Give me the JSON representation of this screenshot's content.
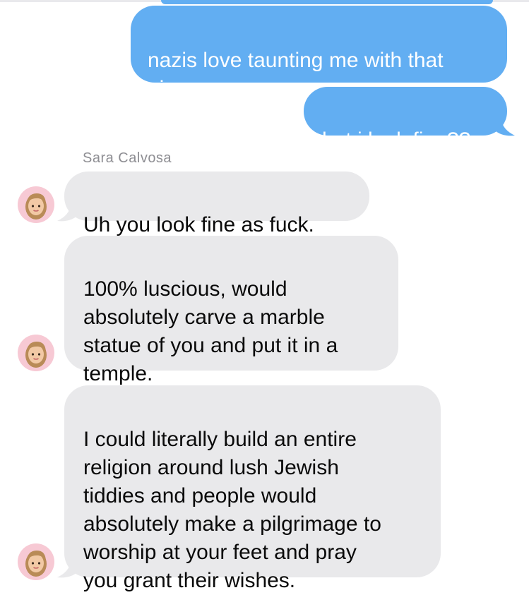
{
  "conversation": {
    "sender_name": "Sara Calvosa",
    "colors": {
      "outgoing_bubble": "#62aef2",
      "incoming_bubble": "#e9e9eb",
      "sender_label": "#8e8e93",
      "avatar_background": "#f7c9d4"
    },
    "avatar_icon": "memoji-avatar-icon",
    "messages": [
      {
        "direction": "outgoing",
        "text": "nazis love taunting me with that\npic"
      },
      {
        "direction": "outgoing",
        "text": "but i look fine??"
      },
      {
        "direction": "incoming",
        "text": "Uh you look fine as fuck."
      },
      {
        "direction": "incoming",
        "text": "100% luscious, would\nabsolutely carve a marble\nstatue of you and put it in a\ntemple."
      },
      {
        "direction": "incoming",
        "text": "I could literally build an entire\nreligion around lush Jewish\ntiddies and people would\nabsolutely make a pilgrimage to\nworship at your feet and pray\nyou grant their wishes."
      }
    ]
  }
}
